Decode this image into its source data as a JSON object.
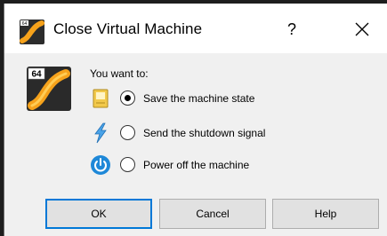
{
  "dialog": {
    "title": "Close Virtual Machine",
    "help_label": "?",
    "prompt": "You want to:",
    "vm_badge": "64",
    "options": [
      {
        "icon": "save-state-icon",
        "label": "Save the machine state",
        "selected": true
      },
      {
        "icon": "shutdown-signal-icon",
        "label": "Send the shutdown signal",
        "selected": false
      },
      {
        "icon": "power-off-icon",
        "label": "Power off the machine",
        "selected": false
      }
    ],
    "buttons": {
      "ok": "OK",
      "cancel": "Cancel",
      "help": "Help"
    }
  },
  "colors": {
    "accent": "#0078d7",
    "window_bg": "#f0f0f0",
    "titlebar_bg": "#ffffff"
  }
}
